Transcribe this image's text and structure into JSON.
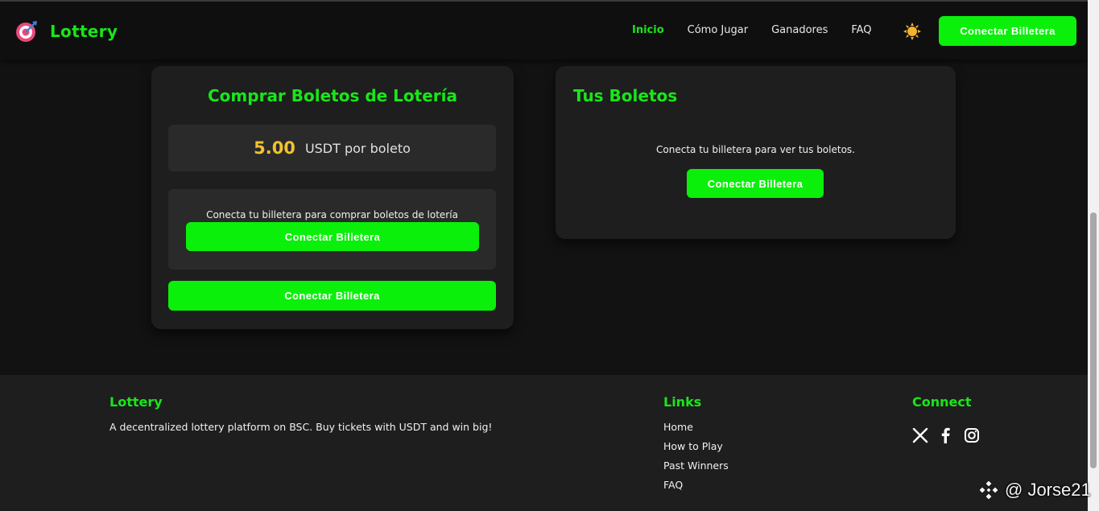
{
  "header": {
    "logo_text": "Lottery",
    "nav": [
      {
        "label": "Inicio",
        "active": true
      },
      {
        "label": "Cómo Jugar",
        "active": false
      },
      {
        "label": "Ganadores",
        "active": false
      },
      {
        "label": "FAQ",
        "active": false
      }
    ],
    "connect_label": "Conectar Billetera",
    "theme_icon": "sun-icon"
  },
  "buy_card": {
    "title": "Comprar Boletos de Lotería",
    "price_value": "5.00",
    "price_unit": "USDT por boleto",
    "connect_message": "Conecta tu billetera para comprar boletos de lotería",
    "connect_label": "Conectar Billetera",
    "bottom_button_label": "Conectar Billetera"
  },
  "tickets_card": {
    "title": "Tus Boletos",
    "message": "Conecta tu billetera para ver tus boletos.",
    "connect_label": "Conectar Billetera"
  },
  "footer": {
    "brand_title": "Lottery",
    "brand_description": "A decentralized lottery platform on BSC. Buy tickets with USDT and win big!",
    "links_title": "Links",
    "links": [
      "Home",
      "How to Play",
      "Past Winners",
      "FAQ"
    ],
    "connect_title": "Connect",
    "social_icons": [
      "x-icon",
      "facebook-icon",
      "instagram-icon"
    ]
  },
  "watermark": {
    "text": "@ Jorse21"
  },
  "colors": {
    "accent": "#19e619",
    "button": "#0af00a",
    "price": "#f2c12e",
    "background": "#121212",
    "card": "#1e1e1e"
  }
}
